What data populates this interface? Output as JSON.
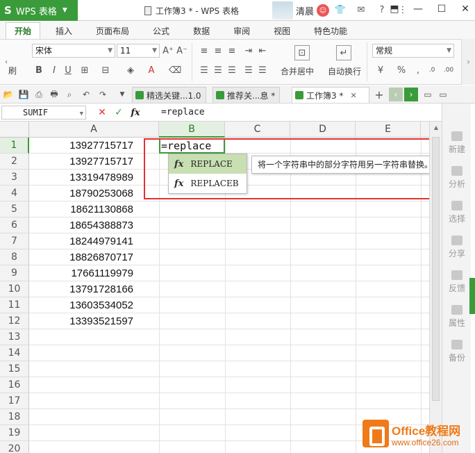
{
  "titlebar": {
    "app_label": "WPS 表格",
    "doc_title": "工作簿3 * - WPS 表格",
    "user_name": "清晨"
  },
  "ribbon_tabs": [
    "开始",
    "插入",
    "页面布局",
    "公式",
    "数据",
    "审阅",
    "视图",
    "特色功能"
  ],
  "ribbon": {
    "paste_fragment_top": "",
    "paste_fragment_bottom": "刷",
    "font_name": "宋体",
    "font_size": "11",
    "merge_center_label": "合并居中",
    "wrap_text_label": "自动换行",
    "number_format": "常规"
  },
  "doc_tabs": [
    {
      "label": "精选关键...1.0",
      "active": false
    },
    {
      "label": "推荐关...息 *",
      "active": false
    },
    {
      "label": "工作簿3 *",
      "active": true
    }
  ],
  "formula_bar": {
    "name_box": "SUMIF",
    "formula": "=replace"
  },
  "columns": [
    "A",
    "B",
    "C",
    "D",
    "E"
  ],
  "rows": [
    "1",
    "2",
    "3",
    "4",
    "5",
    "6",
    "7",
    "8",
    "9",
    "10",
    "11",
    "12",
    "13",
    "14",
    "15",
    "16",
    "17",
    "18",
    "19",
    "20"
  ],
  "column_a_values": [
    "13927715717",
    "13927715717",
    "13319478989",
    "18790253068",
    "18621130868",
    "18654388873",
    "18244979141",
    "18826870717",
    "17661119979",
    "13791728166",
    "13603534052",
    "13393521597"
  ],
  "active_cell": {
    "ref": "B1",
    "text": "=replace"
  },
  "autocomplete": {
    "items": [
      {
        "icon": "fx",
        "label": "REPLACE",
        "selected": true
      },
      {
        "icon": "fx",
        "label": "REPLACEB",
        "selected": false
      }
    ],
    "tooltip": "将一个字符串中的部分字符用另一字符串替换。"
  },
  "sidebar": [
    "新建",
    "分析",
    "选择",
    "分享",
    "反馈",
    "属性",
    "备份"
  ],
  "watermark": {
    "title": "Office教程网",
    "url": "www.office26.com"
  },
  "colors": {
    "accent": "#3a9b3a",
    "highlight_box": "#e53030",
    "watermark": "#f07a18"
  }
}
